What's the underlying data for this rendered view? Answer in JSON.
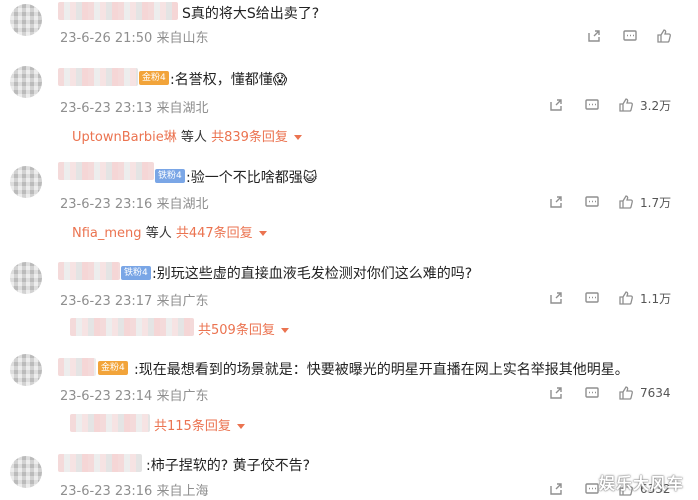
{
  "comments": [
    {
      "text": "S真的将大S给出卖了?",
      "meta": "23-6-26 21:50 来自山东",
      "like_count": ""
    },
    {
      "badge": "金粉4",
      "text": ":名誉权，懂都懂😱",
      "meta": "23-6-23 23:13 来自湖北",
      "like_count": "3.2万",
      "reply_name": "UptownBarbie琳",
      "reply_etc": "等人",
      "reply_count": "共839条回复"
    },
    {
      "badge": "铁粉4",
      "text": ":验一个不比啥都强😺",
      "meta": "23-6-23 23:16 来自湖北",
      "like_count": "1.7万",
      "reply_name": "Nfia_meng",
      "reply_etc": "等人",
      "reply_count": "共447条回复"
    },
    {
      "badge": "铁粉4",
      "text": ":别玩这些虚的直接血液毛发检测对你们这么难的吗?",
      "meta": "23-6-23 23:17 来自广东",
      "like_count": "1.1万",
      "reply_count": "共509条回复"
    },
    {
      "badge": "金粉4",
      "text": ":现在最想看到的场景就是：快要被曝光的明星开直播在网上实名举报其他明星。",
      "meta": "23-6-23 23:14 来自广东",
      "like_count": "7634",
      "reply_count": "共115条回复"
    },
    {
      "text": ":柿子捏软的? 黄子佼不告?",
      "meta": "23-6-23 23:16 来自上海",
      "like_count": "6332"
    }
  ],
  "watermark": "娱乐大风车",
  "icons": {
    "share": "share-icon",
    "comment": "comment-icon",
    "like": "thumbs-up-icon"
  },
  "colors": {
    "accent": "#eb7350",
    "meta": "#8f8f8f",
    "badge_gold": "#f2a43a",
    "badge_blue": "#7aa6e6"
  }
}
